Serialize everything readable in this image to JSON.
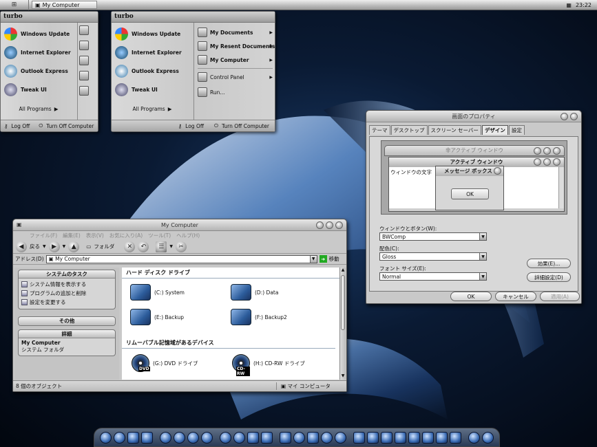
{
  "taskbar": {
    "task_label": "My Computer",
    "clock": "23:22"
  },
  "start_menu": {
    "user": "turbo",
    "pinned": [
      "Windows Update",
      "Internet Explorer",
      "Outlook Express",
      "Tweak UI"
    ],
    "all_programs": "All Programs",
    "log_off": "Log Off",
    "turn_off": "Turn Off Computer",
    "right": [
      "My Documents",
      "My Resent Documents",
      "My Computer",
      "Control Panel",
      "Run..."
    ]
  },
  "display": {
    "title": "画面のプロパティ",
    "tabs": [
      "テーマ",
      "デスクトップ",
      "スクリーン セーバー",
      "デザイン",
      "設定"
    ],
    "inactive_title": "非アクティブ ウィンドウ",
    "active_title": "アクティブ ウィンドウ",
    "window_text": "ウィンドウの文字",
    "msgbox_title": "メッセージ ボックス",
    "msgbox_ok": "OK",
    "style_label": "ウィンドウとボタン(W):",
    "style_value": "BWComp",
    "scheme_label": "配色(C):",
    "scheme_value": "Gloss",
    "font_label": "フォント サイズ(E):",
    "font_value": "Normal",
    "effects": "効果(E)...",
    "advanced": "詳細設定(D)",
    "ok": "OK",
    "cancel": "キャンセル",
    "apply": "適用(A)"
  },
  "explorer": {
    "title": "My Computer",
    "menu": [
      "ファイル(F)",
      "編集(E)",
      "表示(V)",
      "お気に入り(A)",
      "ツール(T)",
      "ヘルプ(H)"
    ],
    "back": "戻る",
    "folders": "フォルダ",
    "address_label": "アドレス(D)",
    "address": "My Computer",
    "go": "移動",
    "tasks_title": "システムのタスク",
    "tasks": [
      "システム情報を表示する",
      "プログラムの追加と削除",
      "設定を変更する"
    ],
    "other_title": "その他",
    "details_title": "詳細",
    "details_name": "My Computer",
    "details_type": "システム フォルダ",
    "hdd_header": "ハード ディスク ドライブ",
    "drives": [
      "(C:) System",
      "(D:) Data",
      "(E:) Backup",
      "(F:) Backup2"
    ],
    "removable_header": "リムーバブル記憶域があるデバイス",
    "removable": [
      "(G:) DVD ドライブ",
      "(H:) CD-RW ドライブ"
    ],
    "dvd_tag": "DVD",
    "cdrw_tag": "CD-RW",
    "status": "8 個のオブジェクト",
    "status_right": "マイ コンピュータ"
  }
}
